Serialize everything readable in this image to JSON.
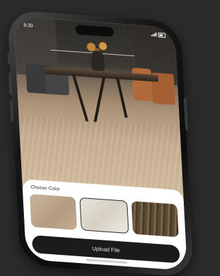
{
  "status_bar": {
    "time": "9:30"
  },
  "sheet": {
    "title": "Choose Color",
    "upload_label": "Upload File"
  },
  "swatches": [
    {
      "name": "beige-oak",
      "color": "#c2ad92",
      "selected": false
    },
    {
      "name": "light-grey-oak",
      "color": "#e3ded3",
      "selected": true
    },
    {
      "name": "dark-walnut",
      "color": "#5c4a35",
      "selected": false
    }
  ],
  "colors": {
    "background": "#2b2b2b",
    "button": "#1b1b1b",
    "sheet": "#ffffff"
  },
  "icons": [
    "signal-icon",
    "battery-icon"
  ]
}
